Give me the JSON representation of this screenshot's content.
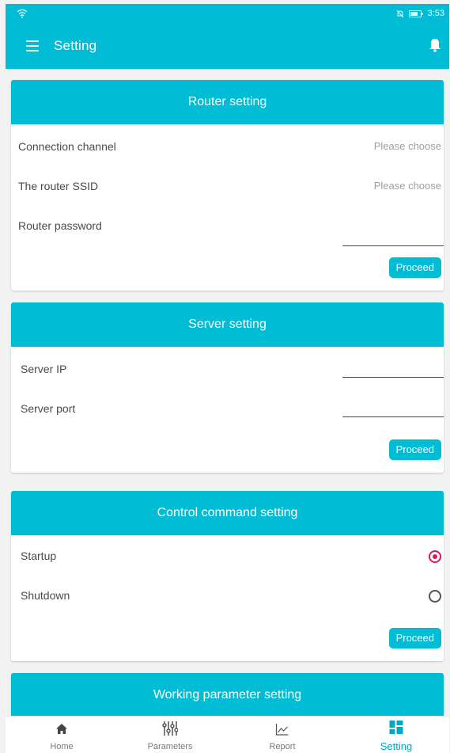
{
  "status": {
    "time": "3:53"
  },
  "appbar": {
    "title": "Setting"
  },
  "router": {
    "header": "Router setting",
    "channel_label": "Connection channel",
    "channel_value": "Please choose",
    "ssid_label": "The router SSID",
    "ssid_value": "Please choose",
    "password_label": "Router password",
    "password_value": "",
    "proceed_label": "Proceed"
  },
  "server": {
    "header": "Server setting",
    "ip_label": "Server IP",
    "ip_value": "",
    "port_label": "Server port",
    "port_value": "",
    "proceed_label": "Proceed"
  },
  "control": {
    "header": "Control command setting",
    "startup_label": "Startup",
    "shutdown_label": "Shutdown",
    "selected": "Startup",
    "proceed_label": "Proceed"
  },
  "working": {
    "header": "Working parameter setting"
  },
  "nav": {
    "items": [
      {
        "label": "Home",
        "icon": "home-icon"
      },
      {
        "label": "Parameters",
        "icon": "sliders-icon"
      },
      {
        "label": "Report",
        "icon": "line-chart-icon"
      },
      {
        "label": "Setting",
        "icon": "dashboard-icon"
      }
    ],
    "active": "Setting"
  },
  "colors": {
    "primary": "#00bcd4",
    "radio_selected": "#d81b60",
    "background": "#f2f2f2"
  }
}
